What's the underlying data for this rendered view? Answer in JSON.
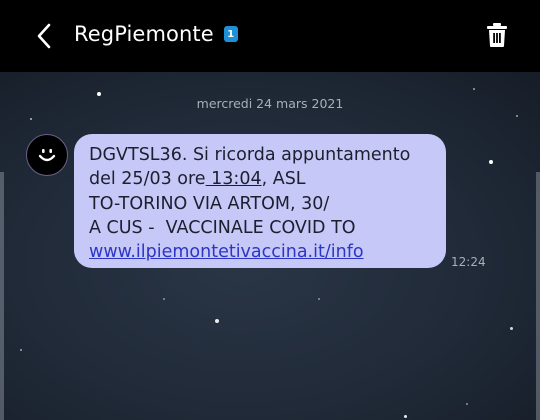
{
  "header": {
    "title": "RegPiemonte",
    "sim_badge": "1",
    "back_icon": "chevron-left-icon",
    "delete_icon": "trash-icon"
  },
  "conversation": {
    "date_separator": "mercredi 24 mars 2021",
    "avatar_icon": "smiley-face-icon",
    "message": {
      "line1": "DGVTSL36. Si ricorda appuntamento",
      "line2_prefix": "del 25/03 ore",
      "line2_link": " 13:04",
      "line2_suffix": ", ASL",
      "line3": "TO-TORINO VIA ARTOM, 30/",
      "line4": "A CUS -  VACCINALE COVID TO",
      "link": "www.ilpiemontetivaccina.it/info",
      "time": "12:24"
    }
  },
  "colors": {
    "app_bar": "#000000",
    "bubble": "#c6c9f7",
    "link": "#2d35c6",
    "badge": "#1e90d6"
  }
}
